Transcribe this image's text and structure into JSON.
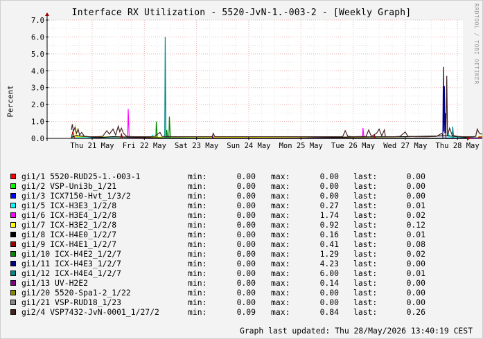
{
  "window": {
    "title": "Interface RX Utilization - 5520-JvN-1.-003-2 - [Weekly Graph]",
    "watermark": "RRDTOOL / TOBI OETIKER",
    "footer": "Graph last updated: Thu 28/May/2026 13:40:19 CEST"
  },
  "chart_data": {
    "type": "line",
    "title": "Interface RX Utilization - 5520-JvN-1.-003-2 - [Weekly Graph]",
    "ylabel": "Percent",
    "xlabel": "",
    "ylim": [
      0,
      7
    ],
    "yticks": [
      "0.0",
      "1.0",
      "2.0",
      "3.0",
      "4.0",
      "5.0",
      "6.0",
      "7.0"
    ],
    "xticks": [
      "Thu 21 May",
      "Fri 22 May",
      "Sat 23 May",
      "Sun 24 May",
      "Mon 25 May",
      "Tue 26 May",
      "Wed 27 May",
      "Thu 28 May"
    ],
    "x_range_days": [
      0,
      7.55
    ],
    "grid": true,
    "legend": "bottom",
    "series": [
      {
        "name": "gi1/1 5520-RUD25-1.-003-1",
        "color": "#FF0000",
        "min": "0.00",
        "max": "0.00",
        "last": "0.00",
        "points": []
      },
      {
        "name": "gi1/2 VSP-Uni3b_1/21",
        "color": "#00FF00",
        "min": "0.00",
        "max": "0.00",
        "last": "0.00",
        "points": []
      },
      {
        "name": "gi1/3 ICX7150-Hvt_1/3/2",
        "color": "#0000FF",
        "min": "0.00",
        "max": "0.00",
        "last": "0.00",
        "points": []
      },
      {
        "name": "gi1/5 ICX-H3E3_1/2/8",
        "color": "#00FFFF",
        "min": "0.00",
        "max": "0.27",
        "last": "0.01",
        "points": [
          [
            -0.4,
            0
          ],
          [
            -0.39,
            0.2
          ],
          [
            -0.36,
            0.05
          ],
          [
            1.15,
            0
          ],
          [
            1.16,
            0.22
          ],
          [
            1.18,
            0.05
          ],
          [
            6.82,
            0
          ],
          [
            6.83,
            0.27
          ],
          [
            6.86,
            0.05
          ],
          [
            7.55,
            0.01
          ]
        ]
      },
      {
        "name": "gi1/6 ICX-H3E4_1/2/8",
        "color": "#FF00FF",
        "min": "0.00",
        "max": "1.74",
        "last": "0.02",
        "points": [
          [
            0.68,
            0
          ],
          [
            0.69,
            1.74
          ],
          [
            0.71,
            0
          ],
          [
            5.18,
            0
          ],
          [
            5.19,
            0.62
          ],
          [
            5.21,
            0
          ],
          [
            7.55,
            0.02
          ]
        ]
      },
      {
        "name": "gi1/7 ICX-H3E2_1/2/8",
        "color": "#FFFF00",
        "min": "0.00",
        "max": "0.92",
        "last": "0.12",
        "points": [
          [
            -0.33,
            0
          ],
          [
            -0.32,
            0.92
          ],
          [
            -0.3,
            0.1
          ],
          [
            7.4,
            0
          ],
          [
            7.41,
            0.12
          ],
          [
            7.55,
            0.12
          ]
        ]
      },
      {
        "name": "gi1/8 ICX-H4E0_1/2/7",
        "color": "#000000",
        "min": "0.00",
        "max": "0.16",
        "last": "0.01",
        "points": [
          [
            -0.4,
            0.05
          ],
          [
            -0.35,
            0.12
          ],
          [
            -0.3,
            0.16
          ],
          [
            0.1,
            0.05
          ],
          [
            0.4,
            0.1
          ],
          [
            0.6,
            0.08
          ],
          [
            1.0,
            0.05
          ],
          [
            1.5,
            0.02
          ],
          [
            2.5,
            0.01
          ],
          [
            4.0,
            0.02
          ],
          [
            5.0,
            0.08
          ],
          [
            6.0,
            0.1
          ],
          [
            6.8,
            0.15
          ],
          [
            7.2,
            0.05
          ],
          [
            7.55,
            0.01
          ]
        ]
      },
      {
        "name": "gi1/9 ICX-H4E1_1/2/7",
        "color": "#990000",
        "min": "0.00",
        "max": "0.41",
        "last": "0.08",
        "points": [
          [
            -0.4,
            0
          ],
          [
            -0.37,
            0.41
          ],
          [
            -0.34,
            0
          ],
          [
            0.55,
            0
          ],
          [
            0.56,
            0.3
          ],
          [
            0.58,
            0
          ],
          [
            5.4,
            0
          ],
          [
            5.41,
            0.2
          ],
          [
            5.43,
            0
          ],
          [
            7.4,
            0
          ],
          [
            7.41,
            0.08
          ],
          [
            7.55,
            0.08
          ]
        ]
      },
      {
        "name": "gi1/10 ICX-H4E2_1/2/7",
        "color": "#008800",
        "min": "0.00",
        "max": "1.29",
        "last": "0.02",
        "points": [
          [
            1.22,
            0
          ],
          [
            1.23,
            1.0
          ],
          [
            1.25,
            0
          ],
          [
            1.42,
            0
          ],
          [
            1.43,
            0.5
          ],
          [
            1.45,
            0
          ],
          [
            1.47,
            0
          ],
          [
            1.48,
            1.29
          ],
          [
            1.5,
            0
          ],
          [
            7.55,
            0.02
          ]
        ]
      },
      {
        "name": "gi1/11 ICX-H4E3_1/2/7",
        "color": "#000088",
        "min": "0.00",
        "max": "4.23",
        "last": "0.00",
        "points": [
          [
            6.72,
            0
          ],
          [
            6.73,
            4.23
          ],
          [
            6.74,
            0.4
          ],
          [
            6.75,
            3.1
          ],
          [
            6.76,
            0.3
          ],
          [
            6.77,
            1.5
          ],
          [
            6.78,
            0
          ],
          [
            7.55,
            0
          ]
        ]
      },
      {
        "name": "gi1/12 ICX-H4E4_1/2/7",
        "color": "#008888",
        "min": "0.00",
        "max": "6.00",
        "last": "0.01",
        "points": [
          [
            1.39,
            0
          ],
          [
            1.4,
            6.0
          ],
          [
            1.415,
            0
          ],
          [
            6.9,
            0
          ],
          [
            6.91,
            0.7
          ],
          [
            6.93,
            0
          ],
          [
            7.55,
            0.01
          ]
        ]
      },
      {
        "name": "gi1/13 UV-H2E2",
        "color": "#880088",
        "min": "0.00",
        "max": "0.14",
        "last": "0.00",
        "points": [
          [
            2.3,
            0
          ],
          [
            2.31,
            0.14
          ],
          [
            2.33,
            0
          ],
          [
            7.55,
            0
          ]
        ]
      },
      {
        "name": "gi1/20 5520-Spa1-2_1/22",
        "color": "#888800",
        "min": "0.00",
        "max": "0.00",
        "last": "0.00",
        "points": []
      },
      {
        "name": "gi1/21 VSP-RUD18_1/23",
        "color": "#888888",
        "min": "0.00",
        "max": "0.00",
        "last": "0.00",
        "points": []
      },
      {
        "name": "gi2/4 VSP7432-JvN-0001_1/27/2",
        "color": "#442222",
        "min": "0.09",
        "max": "0.84",
        "last": "0.26",
        "points": [
          [
            -0.4,
            0.5
          ],
          [
            -0.38,
            0.84
          ],
          [
            -0.36,
            0.4
          ],
          [
            -0.33,
            0.65
          ],
          [
            -0.3,
            0.3
          ],
          [
            -0.27,
            0.55
          ],
          [
            -0.24,
            0.2
          ],
          [
            -0.2,
            0.35
          ],
          [
            -0.15,
            0.12
          ],
          [
            -0.05,
            0.1
          ],
          [
            0.1,
            0.1
          ],
          [
            0.2,
            0.12
          ],
          [
            0.28,
            0.45
          ],
          [
            0.33,
            0.25
          ],
          [
            0.4,
            0.55
          ],
          [
            0.45,
            0.2
          ],
          [
            0.5,
            0.72
          ],
          [
            0.53,
            0.38
          ],
          [
            0.56,
            0.6
          ],
          [
            0.6,
            0.3
          ],
          [
            0.66,
            0.12
          ],
          [
            0.8,
            0.1
          ],
          [
            1.1,
            0.1
          ],
          [
            1.2,
            0.12
          ],
          [
            1.3,
            0.35
          ],
          [
            1.34,
            0.12
          ],
          [
            1.55,
            0.1
          ],
          [
            2.0,
            0.1
          ],
          [
            2.3,
            0.1
          ],
          [
            2.32,
            0.3
          ],
          [
            2.35,
            0.1
          ],
          [
            3.0,
            0.1
          ],
          [
            3.5,
            0.1
          ],
          [
            4.0,
            0.1
          ],
          [
            4.5,
            0.1
          ],
          [
            4.8,
            0.1
          ],
          [
            4.85,
            0.45
          ],
          [
            4.9,
            0.12
          ],
          [
            5.0,
            0.1
          ],
          [
            5.25,
            0.12
          ],
          [
            5.3,
            0.5
          ],
          [
            5.35,
            0.12
          ],
          [
            5.45,
            0.3
          ],
          [
            5.5,
            0.55
          ],
          [
            5.55,
            0.15
          ],
          [
            5.6,
            0.5
          ],
          [
            5.62,
            0.1
          ],
          [
            5.8,
            0.1
          ],
          [
            5.9,
            0.12
          ],
          [
            6.0,
            0.38
          ],
          [
            6.05,
            0.12
          ],
          [
            6.2,
            0.1
          ],
          [
            6.4,
            0.1
          ],
          [
            6.6,
            0.12
          ],
          [
            6.7,
            0.3
          ],
          [
            6.72,
            0.15
          ],
          [
            6.78,
            0.15
          ],
          [
            6.795,
            3.7
          ],
          [
            6.81,
            0.15
          ],
          [
            6.85,
            0.6
          ],
          [
            6.9,
            0.18
          ],
          [
            7.0,
            0.12
          ],
          [
            7.1,
            0.1
          ],
          [
            7.3,
            0.1
          ],
          [
            7.35,
            0.12
          ],
          [
            7.38,
            0.55
          ],
          [
            7.42,
            0.3
          ],
          [
            7.45,
            0.26
          ],
          [
            7.55,
            0.26
          ]
        ]
      }
    ]
  },
  "legend_labels": {
    "min": "min:",
    "max": "max:",
    "last": "last:"
  }
}
